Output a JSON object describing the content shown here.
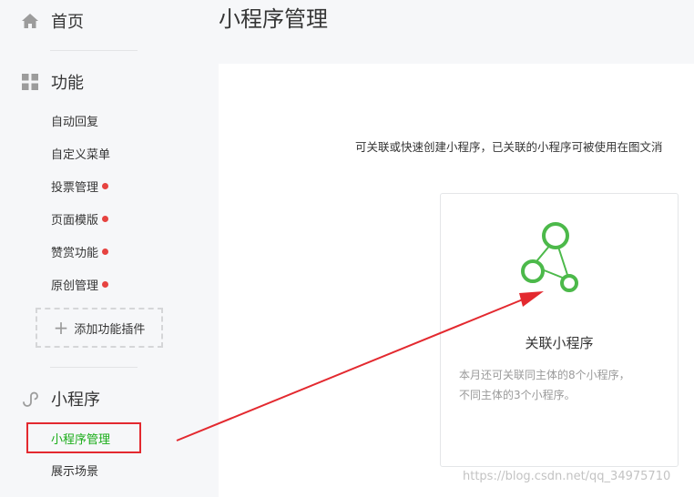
{
  "sidebar": {
    "home_label": "首页",
    "features": {
      "heading": "功能",
      "items": [
        {
          "label": "自动回复",
          "has_dot": false
        },
        {
          "label": "自定义菜单",
          "has_dot": false
        },
        {
          "label": "投票管理",
          "has_dot": true
        },
        {
          "label": "页面模版",
          "has_dot": true
        },
        {
          "label": "赞赏功能",
          "has_dot": true
        },
        {
          "label": "原创管理",
          "has_dot": true
        }
      ],
      "add_plugin_label": "添加功能插件"
    },
    "miniprogram": {
      "heading": "小程序",
      "items": [
        {
          "label": "小程序管理",
          "active": true
        },
        {
          "label": "展示场景",
          "active": false
        }
      ]
    }
  },
  "main": {
    "title": "小程序管理",
    "hint": "可关联或快速创建小程序，已关联的小程序可被使用在图文消",
    "card": {
      "title": "关联小程序",
      "desc_line1": "本月还可关联同主体的8个小程序，",
      "desc_line2": "不同主体的3个小程序。",
      "icon": "link-nodes-icon"
    }
  },
  "watermark": "https://blog.csdn.net/qq_34975710",
  "colors": {
    "accent_green": "#1aad19",
    "icon_green": "#4cb94a",
    "badge_red": "#e64340",
    "annotation_red": "#e3292f"
  }
}
